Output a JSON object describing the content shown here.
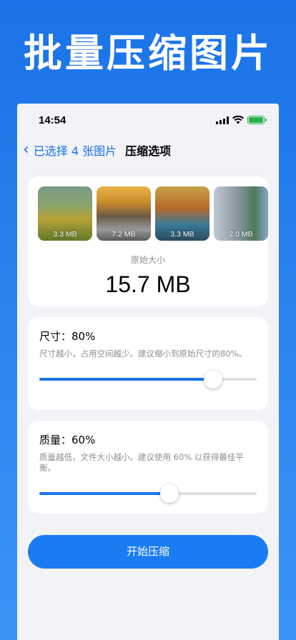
{
  "promo": {
    "title": "批量压缩图片"
  },
  "status_bar": {
    "time": "14:54"
  },
  "nav": {
    "back_label": "已选择 4 张图片",
    "title": "压缩选项"
  },
  "images": {
    "thumbnails": [
      {
        "size": "3.3 MB"
      },
      {
        "size": "7.2 MB"
      },
      {
        "size": "3.3 MB"
      },
      {
        "size": "2.0 MB"
      }
    ],
    "original_label": "原始大小",
    "original_value": "15.7 MB"
  },
  "size_setting": {
    "title": "尺寸：80%",
    "description": "尺寸越小，占用空间越少。建议缩小到原始尺寸的80%。",
    "value": 0.8
  },
  "quality_setting": {
    "title": "质量：60%",
    "description": "质量越低，文件大小越小。建议使用 60% 以获得最佳平衡。",
    "value": 0.6
  },
  "start_button": {
    "label": "开始压缩"
  },
  "colors": {
    "accent": "#1a73e8",
    "battery": "#2bb24c"
  }
}
